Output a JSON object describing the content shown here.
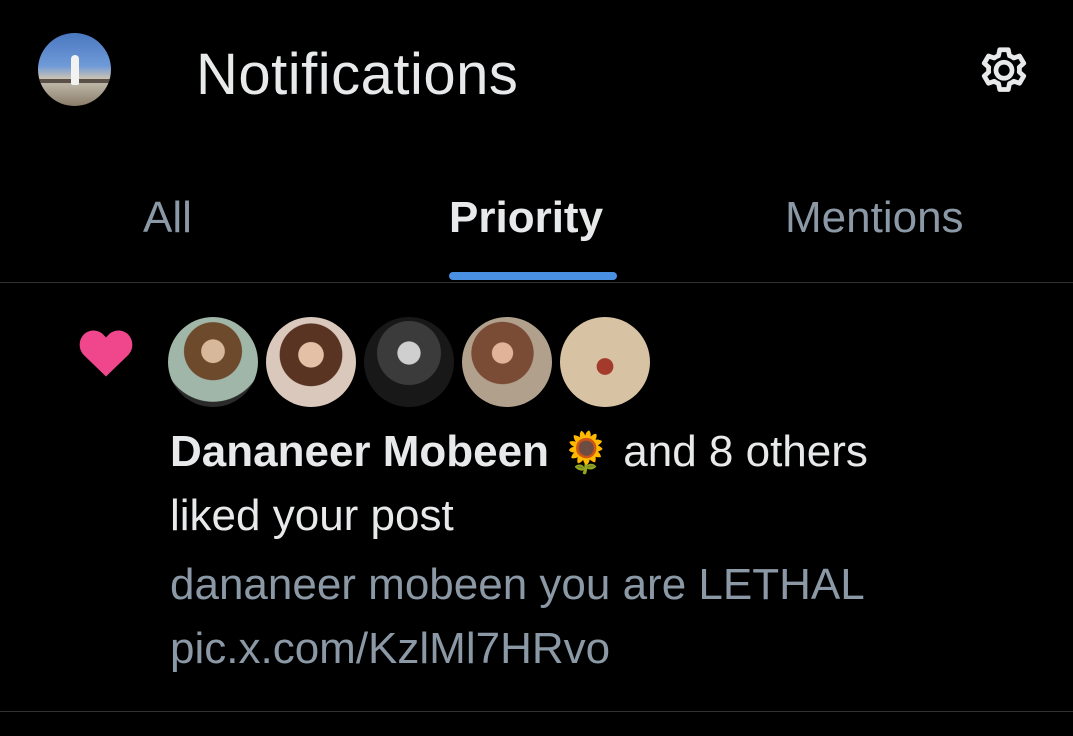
{
  "header": {
    "title": "Notifications",
    "avatar_icon": "profile-avatar",
    "settings_icon": "gear-icon"
  },
  "tabs": [
    {
      "label": "All",
      "active": false
    },
    {
      "label": "Priority",
      "active": true
    },
    {
      "label": "Mentions",
      "active": false
    }
  ],
  "colors": {
    "background": "#000000",
    "text_primary": "#e7e9ea",
    "text_secondary": "#8b98a5",
    "accent": "#4a90e2",
    "like": "#f0468c",
    "divider": "#2f3336"
  },
  "notification": {
    "type_icon": "heart-icon",
    "actor_name": "Dananeer Mobeen",
    "actor_emoji": "🌻",
    "others_text": "and 8 others",
    "action_text": "liked your post",
    "preview_line1": "dananeer mobeen you are LETHAL",
    "preview_line2": "pic.x.com/KzlMl7HRvo",
    "avatar_count": 5
  }
}
